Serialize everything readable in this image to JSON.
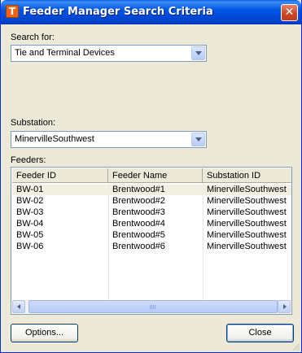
{
  "window": {
    "title": "Feeder Manager Search Criteria",
    "app_icon_glyph": "T",
    "close_glyph": "✕"
  },
  "search": {
    "label": "Search for:",
    "value": "Tie and Terminal Devices"
  },
  "substation": {
    "label": "Substation:",
    "value": "MinervilleSouthwest"
  },
  "feeders": {
    "label": "Feeders:",
    "columns": [
      "Feeder ID",
      "Feeder Name",
      "Substation ID"
    ],
    "rows": [
      [
        "BW-01",
        "Brentwood#1",
        "MinervilleSouthwest"
      ],
      [
        "BW-02",
        "Brentwood#2",
        "MinervilleSouthwest"
      ],
      [
        "BW-03",
        "Brentwood#3",
        "MinervilleSouthwest"
      ],
      [
        "BW-04",
        "Brentwood#4",
        "MinervilleSouthwest"
      ],
      [
        "BW-05",
        "Brentwood#5",
        "MinervilleSouthwest"
      ],
      [
        "BW-06",
        "Brentwood#6",
        "MinervilleSouthwest"
      ]
    ]
  },
  "buttons": {
    "options": "Options...",
    "close": "Close"
  },
  "colors": {
    "titlebar": "#0055e5",
    "close_button": "#c13a1c",
    "dialog_bg": "#ece9d8"
  }
}
